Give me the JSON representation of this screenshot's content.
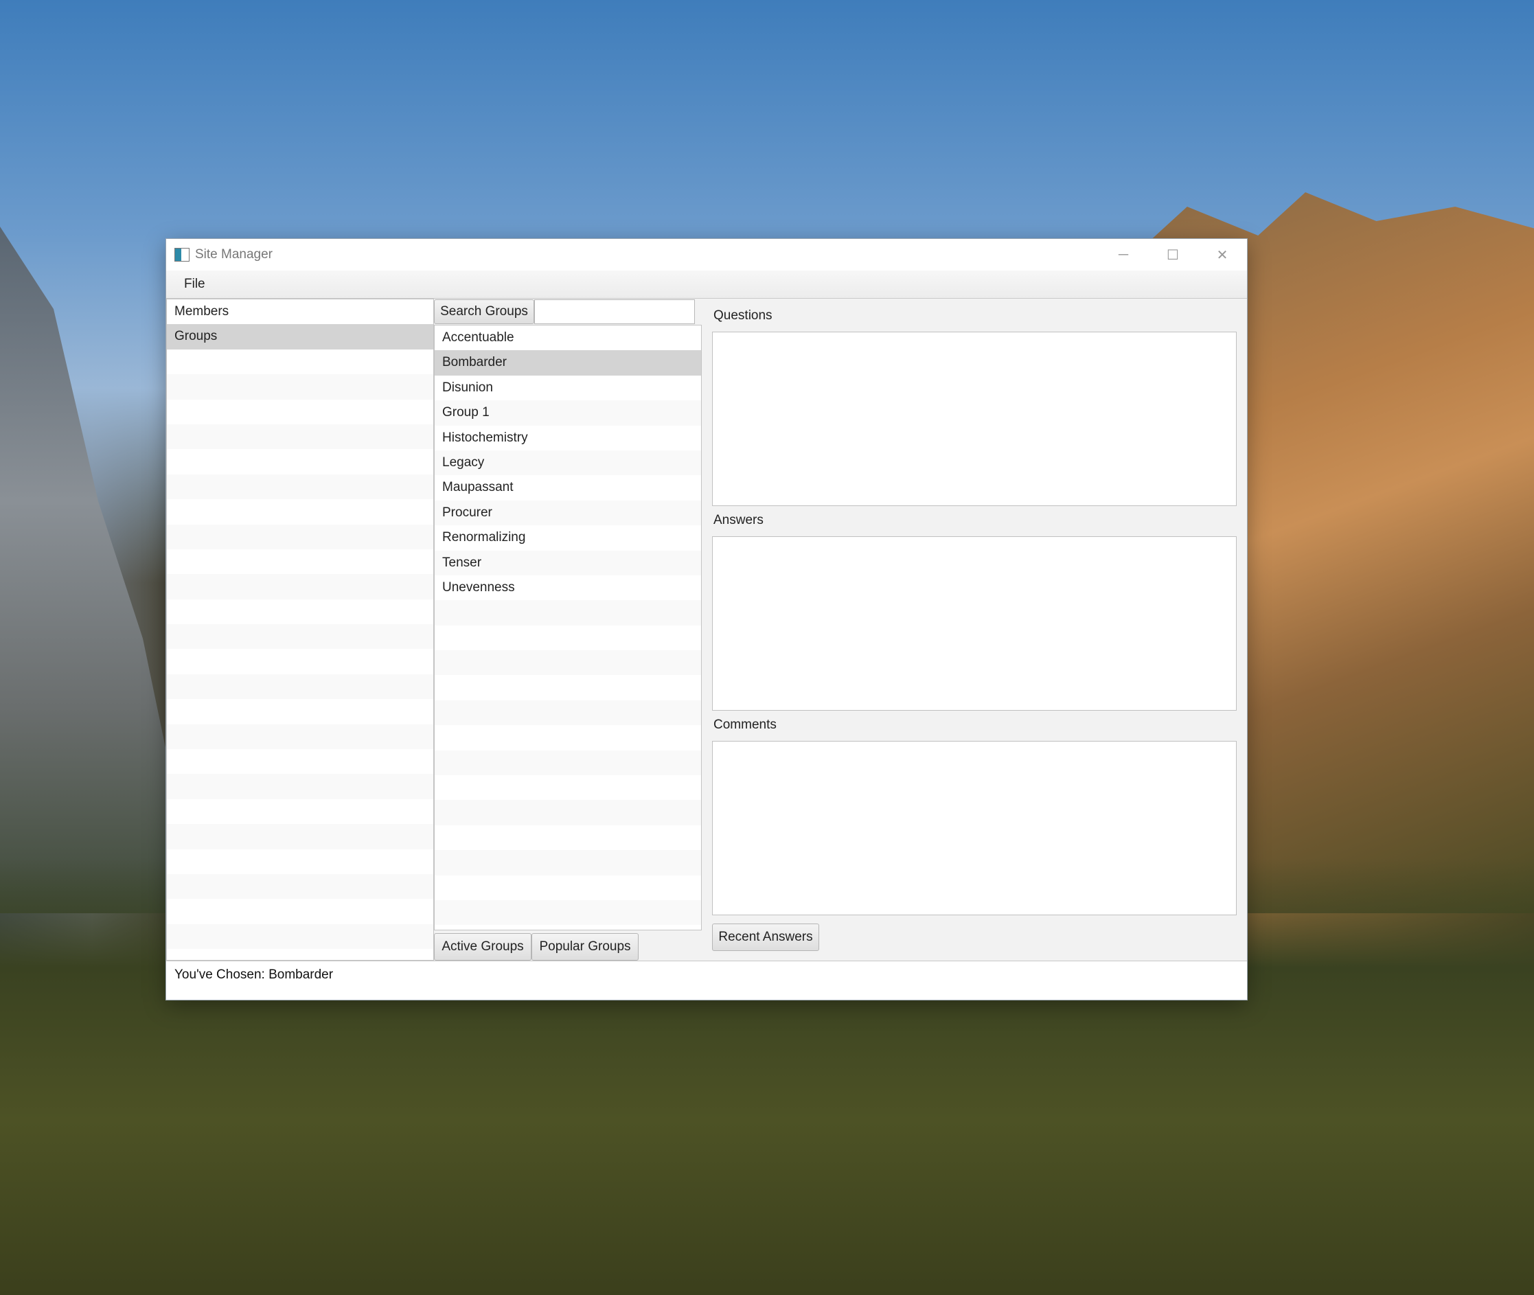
{
  "window": {
    "title": "Site Manager",
    "controls": {
      "minimize": "─",
      "maximize": "☐",
      "close": "✕"
    }
  },
  "menu": {
    "file": "File"
  },
  "left_list": {
    "items": [
      "Members",
      "Groups"
    ],
    "selected": "Groups"
  },
  "search": {
    "button_label": "Search Groups",
    "value": ""
  },
  "groups_list": {
    "items": [
      "Accentuable",
      "Bombarder",
      "Disunion",
      "Group 1",
      "Histochemistry",
      "Legacy",
      "Maupassant",
      "Procurer",
      "Renormalizing",
      "Tenser",
      "Unevenness"
    ],
    "selected": "Bombarder"
  },
  "bottom_buttons": {
    "active": "Active Groups",
    "popular": "Popular Groups"
  },
  "right_panel": {
    "questions_label": "Questions",
    "answers_label": "Answers",
    "comments_label": "Comments",
    "recent_button": "Recent Answers"
  },
  "status": {
    "text": "You've Chosen: Bombarder"
  }
}
